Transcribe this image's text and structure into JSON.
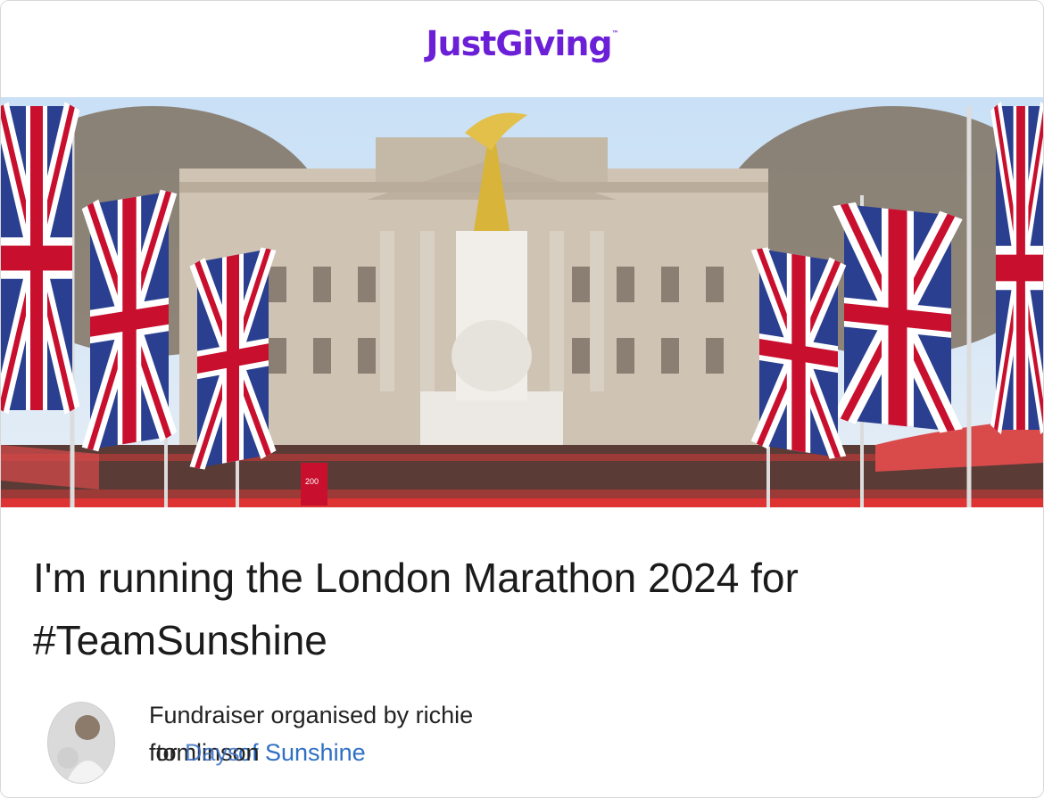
{
  "brand": {
    "logo_text": "JustGiving",
    "tm": "™",
    "color": "#6b1fd6"
  },
  "hero": {
    "image_alt": "Buckingham Palace and the Victoria Memorial with Union Jack flags lining The Mall, marathon runners crowding the road",
    "banner_text": "200"
  },
  "page": {
    "title": "I'm running the London Marathon 2024 for #TeamSunshine"
  },
  "organiser": {
    "line1": "Fundraiser organised by richie",
    "line2_prefix": "for",
    "line2_overlap": "tomlinson",
    "line2_overlap2": "Days",
    "charity_link": "of Sunshine",
    "link_color": "#2f6fc4"
  }
}
